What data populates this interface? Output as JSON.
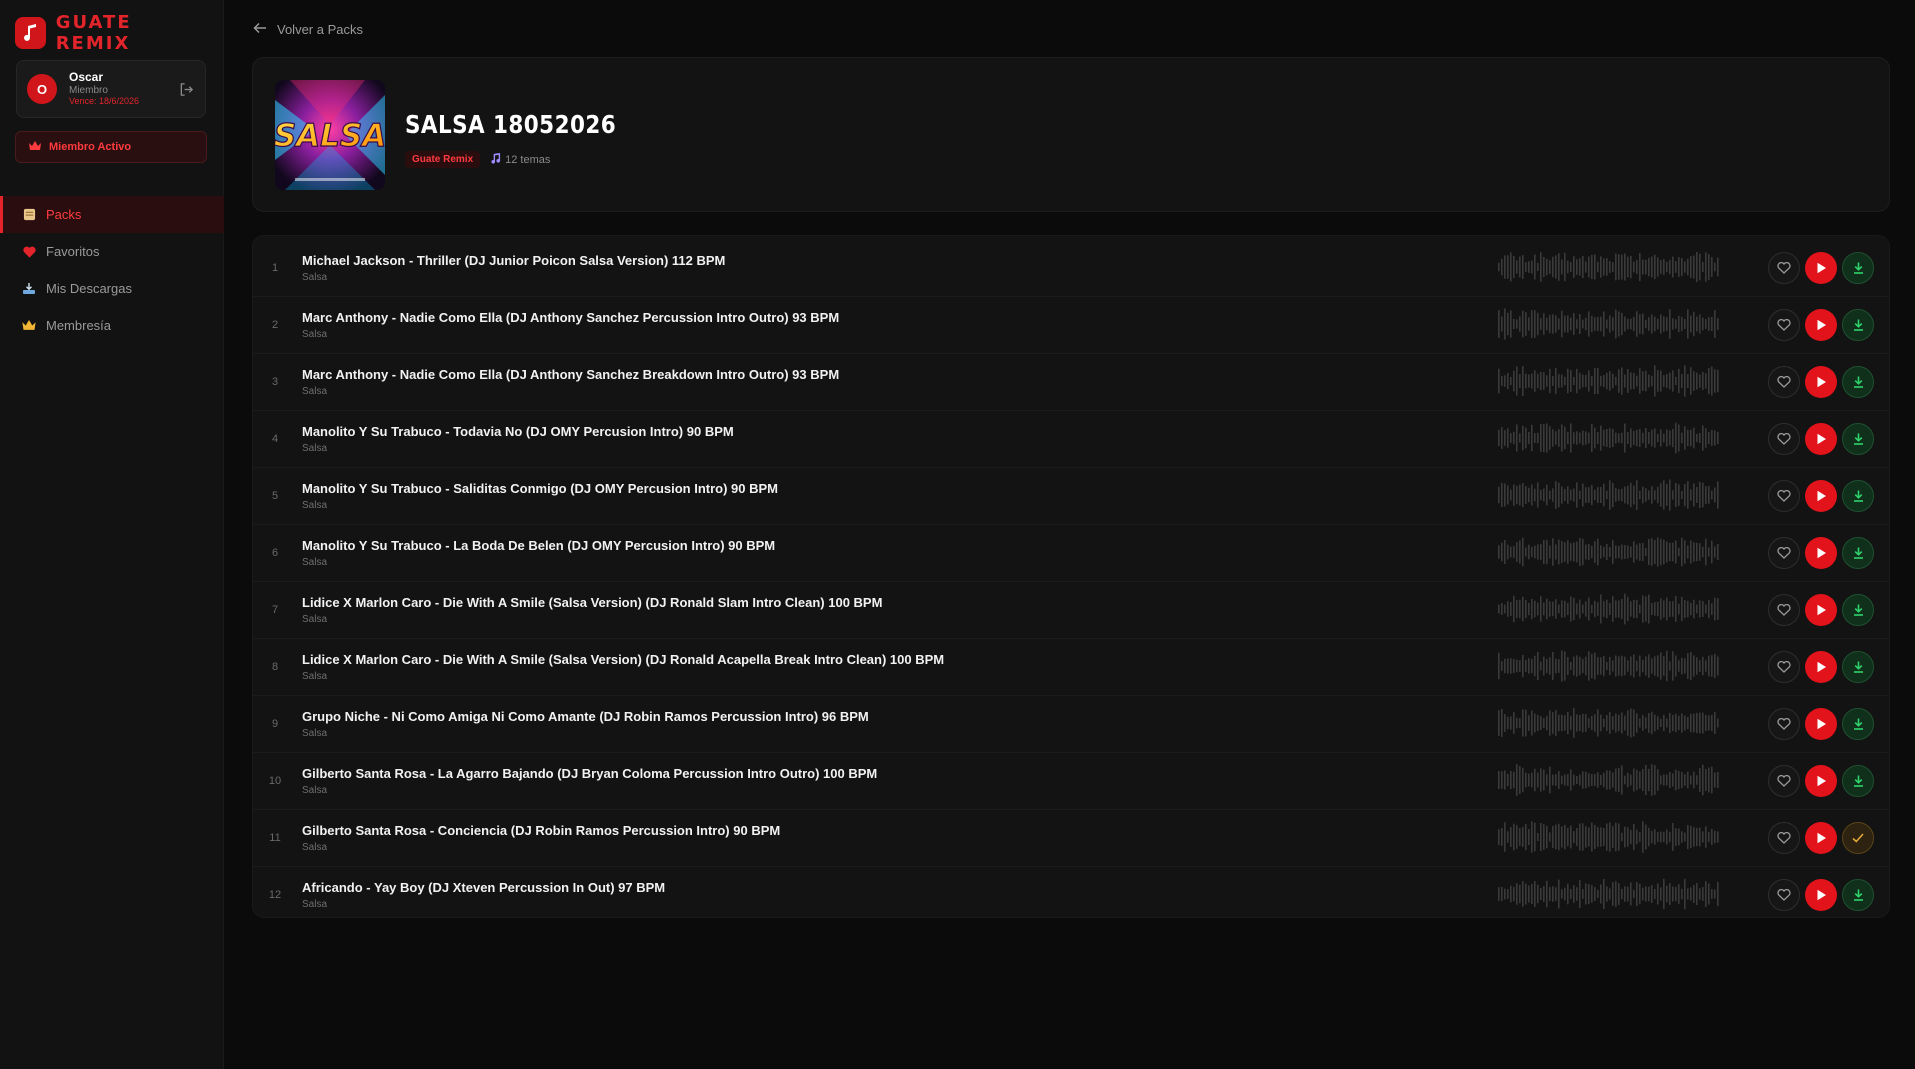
{
  "brand": {
    "name": "GUATE REMIX",
    "logo_icon": "music-note-icon",
    "accent": "#e3242b"
  },
  "user": {
    "initial": "O",
    "name": "Oscar",
    "role": "Miembro",
    "expires": "Vence: 18/6/2026"
  },
  "membership_badge": "Miembro Activo",
  "nav": [
    {
      "label": "Packs",
      "icon": "folder-icon",
      "active": true
    },
    {
      "label": "Favoritos",
      "icon": "heart-icon",
      "active": false
    },
    {
      "label": "Mis Descargas",
      "icon": "download-tray-icon",
      "active": false
    },
    {
      "label": "Membresía",
      "icon": "crown-icon",
      "active": false
    }
  ],
  "back_label": "Volver a Packs",
  "pack": {
    "cover_text": "SALSA",
    "title": "SALSA 18052026",
    "tag": "Guate Remix",
    "count": "12 temas"
  },
  "tracks": [
    {
      "num": "1",
      "title": "Michael Jackson - Thriller (DJ Junior Poicon Salsa Version) 112 BPM",
      "genre": "Salsa",
      "downloaded": false
    },
    {
      "num": "2",
      "title": "Marc Anthony - Nadie Como Ella (DJ Anthony Sanchez Percussion Intro Outro) 93 BPM",
      "genre": "Salsa",
      "downloaded": false
    },
    {
      "num": "3",
      "title": "Marc Anthony - Nadie Como Ella (DJ Anthony Sanchez Breakdown Intro Outro) 93 BPM",
      "genre": "Salsa",
      "downloaded": false
    },
    {
      "num": "4",
      "title": "Manolito Y Su Trabuco - Todavia No (DJ OMY Percusion Intro) 90 BPM",
      "genre": "Salsa",
      "downloaded": false
    },
    {
      "num": "5",
      "title": "Manolito Y Su Trabuco - Saliditas Conmigo (DJ OMY Percusion Intro) 90 BPM",
      "genre": "Salsa",
      "downloaded": false
    },
    {
      "num": "6",
      "title": "Manolito Y Su Trabuco - La Boda De Belen (DJ OMY Percusion Intro) 90 BPM",
      "genre": "Salsa",
      "downloaded": false
    },
    {
      "num": "7",
      "title": "Lidice X Marlon Caro - Die With A Smile (Salsa Version) (DJ Ronald Slam Intro Clean) 100 BPM",
      "genre": "Salsa",
      "downloaded": false
    },
    {
      "num": "8",
      "title": "Lidice X Marlon Caro - Die With A Smile (Salsa Version) (DJ Ronald Acapella Break Intro Clean) 100 BPM",
      "genre": "Salsa",
      "downloaded": false
    },
    {
      "num": "9",
      "title": "Grupo Niche - Ni Como Amiga Ni Como Amante (DJ Robin Ramos Percussion Intro) 96 BPM",
      "genre": "Salsa",
      "downloaded": false
    },
    {
      "num": "10",
      "title": "Gilberto Santa Rosa - La Agarro Bajando (DJ Bryan Coloma Percussion Intro Outro) 100 BPM",
      "genre": "Salsa",
      "downloaded": false
    },
    {
      "num": "11",
      "title": "Gilberto Santa Rosa - Conciencia (DJ Robin Ramos Percussion Intro) 90 BPM",
      "genre": "Salsa",
      "downloaded": true
    },
    {
      "num": "12",
      "title": "Africando - Yay Boy (DJ Xteven Percussion In Out) 97 BPM",
      "genre": "Salsa",
      "downloaded": false
    }
  ]
}
